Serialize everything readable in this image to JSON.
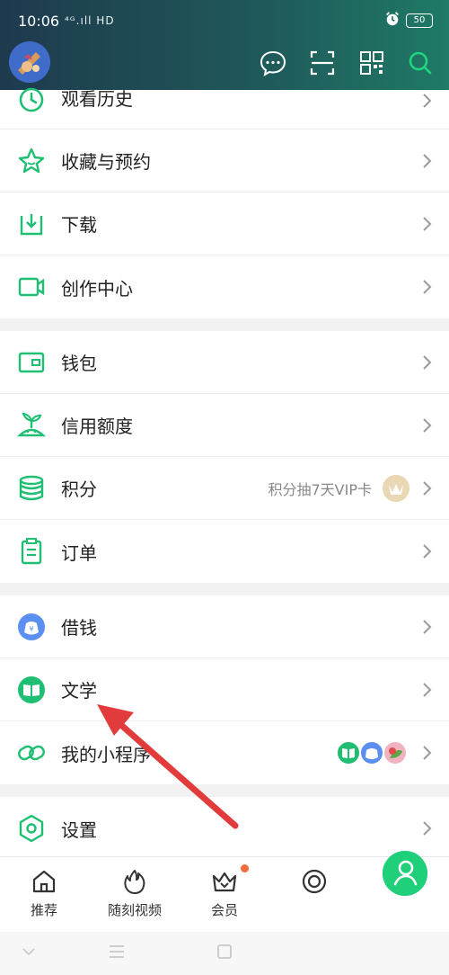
{
  "status": {
    "time": "10:06",
    "signal": "⁴ᴳ.ıll HD",
    "battery": "50"
  },
  "menu": {
    "group1": [
      {
        "label": "观看历史",
        "icon": "clock-icon"
      },
      {
        "label": "收藏与预约",
        "icon": "star-icon"
      },
      {
        "label": "下载",
        "icon": "download-icon"
      },
      {
        "label": "创作中心",
        "icon": "video-camera-icon"
      }
    ],
    "group2": [
      {
        "label": "钱包",
        "icon": "wallet-icon"
      },
      {
        "label": "信用额度",
        "icon": "sprout-icon"
      },
      {
        "label": "积分",
        "icon": "coins-icon",
        "extra": "积分抽7天VIP卡"
      },
      {
        "label": "订单",
        "icon": "clipboard-icon"
      }
    ],
    "group3": [
      {
        "label": "借钱",
        "icon": "money-bag-icon"
      },
      {
        "label": "文学",
        "icon": "book-icon"
      },
      {
        "label": "我的小程序",
        "icon": "link-icon"
      }
    ],
    "group4": [
      {
        "label": "设置",
        "icon": "settings-icon"
      }
    ]
  },
  "tabs": [
    {
      "label": "推荐",
      "icon": "home-icon"
    },
    {
      "label": "随刻视频",
      "icon": "flame-icon"
    },
    {
      "label": "会员",
      "icon": "crown-icon"
    },
    {
      "label": "",
      "icon": "circle-icon"
    }
  ],
  "colors": {
    "accent": "#1fcf7a",
    "arrow": "#e23b3b",
    "header_start": "#1e3a4e",
    "header_end": "#1f7a66"
  }
}
